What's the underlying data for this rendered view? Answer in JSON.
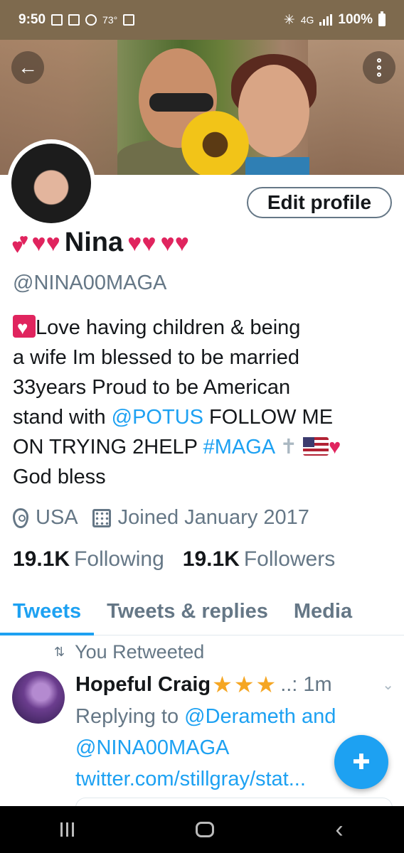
{
  "status_bar": {
    "time": "9:50",
    "temperature": "73°",
    "network": "4G",
    "battery": "100%"
  },
  "profile": {
    "name": "Nina",
    "handle": "@NINA00MAGA",
    "edit_label": "Edit profile",
    "bio": {
      "line1": "Love having children & being",
      "line2": "a wife Im blessed to be married",
      "line3": "33years Proud to be American",
      "line4_prefix": "stand with",
      "line4_link": "@POTUS",
      "line4_suffix": " FOLLOW ME",
      "line5_prefix": "ON TRYING 2HELP",
      "line5_link": "#MAGA",
      "line6": "God bless"
    },
    "location": "USA",
    "joined": "Joined January 2017",
    "following_count": "19.1K",
    "following_label": "Following",
    "followers_count": "19.1K",
    "followers_label": "Followers"
  },
  "tabs": [
    {
      "label": "Tweets",
      "active": true
    },
    {
      "label": "Tweets & replies",
      "active": false
    },
    {
      "label": "Media",
      "active": false
    }
  ],
  "tweet": {
    "retweet_label": "You Retweeted",
    "author": "Hopeful Craig",
    "author_suffix": "..:",
    "time": "1m",
    "replying_prefix": "Replying to",
    "reply_link1": "@Derameth",
    "reply_and": "and",
    "reply_link2": "@NINA00MAGA",
    "url": "twitter.com/stillgray/stat..."
  },
  "colors": {
    "accent": "#1da1f2",
    "muted": "#657786",
    "heart": "#e0245e",
    "star": "#f5a623"
  },
  "icons": [
    "back-arrow-icon",
    "more-vertical-icon",
    "location-pin-icon",
    "calendar-icon",
    "retweet-icon",
    "chevron-down-icon",
    "compose-tweet-icon"
  ]
}
